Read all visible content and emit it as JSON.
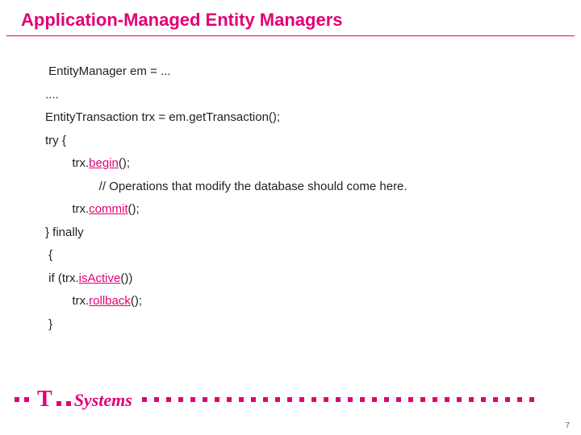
{
  "title": "Application-Managed Entity Managers",
  "code": {
    "l1": " EntityManager em = ...",
    "l2": "....",
    "l3": "EntityTransaction trx = em.getTransaction();",
    "l4": "try {",
    "l5a": "        trx.",
    "l5b": "begin",
    "l5c": "();",
    "l6": "                // Operations that modify the database should come here.",
    "l7a": "        trx.",
    "l7b": "commit",
    "l7c": "();",
    "l8": "} finally",
    "l9": " {",
    "l10a": " if (trx.",
    "l10b": "isActive",
    "l10c": "())",
    "l11a": "        trx.",
    "l11b": "rollback",
    "l11c": "();",
    "l12": " }"
  },
  "logo": {
    "t": "T",
    "text": "Systems"
  },
  "page": "7",
  "colors": {
    "accent": "#e20074"
  }
}
